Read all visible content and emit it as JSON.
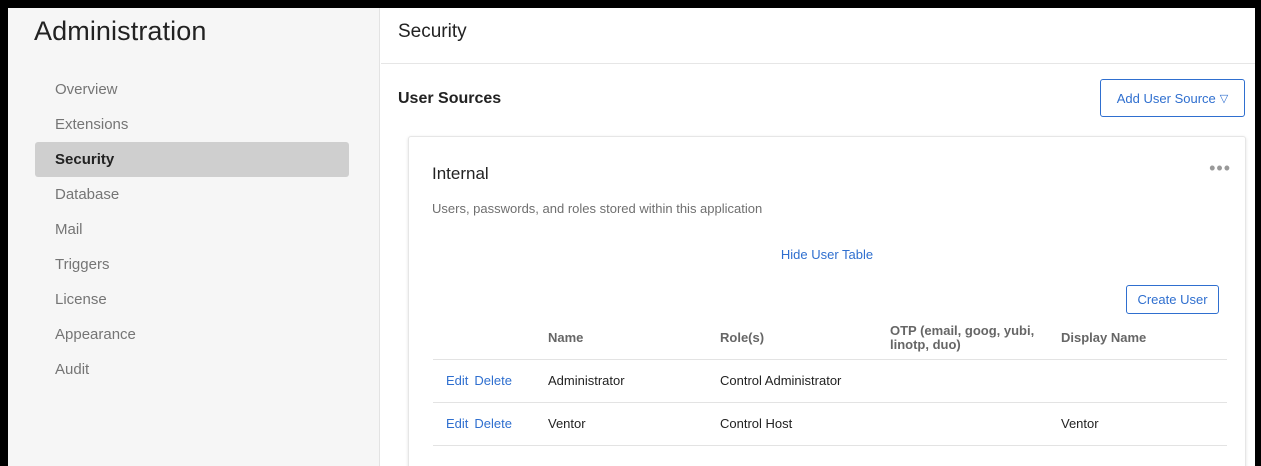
{
  "sidebar": {
    "title": "Administration",
    "items": [
      {
        "label": "Overview",
        "active": false
      },
      {
        "label": "Extensions",
        "active": false
      },
      {
        "label": "Security",
        "active": true
      },
      {
        "label": "Database",
        "active": false
      },
      {
        "label": "Mail",
        "active": false
      },
      {
        "label": "Triggers",
        "active": false
      },
      {
        "label": "License",
        "active": false
      },
      {
        "label": "Appearance",
        "active": false
      },
      {
        "label": "Audit",
        "active": false
      }
    ]
  },
  "header": {
    "title": "Security"
  },
  "user_sources": {
    "title": "User Sources",
    "add_button": "Add User Source",
    "add_button_icon": "caret-down-icon",
    "card": {
      "title": "Internal",
      "menu_icon": "more-horizontal-icon",
      "description": "Users, passwords, and roles stored within this application",
      "toggle_link": "Hide User Table",
      "create_button": "Create User",
      "columns": [
        "Name",
        "Role(s)",
        "OTP (email, goog, yubi, linotp, duo)",
        "Display Name"
      ],
      "rows": [
        {
          "edit": "Edit",
          "delete": "Delete",
          "name": "Administrator",
          "role": "Control Administrator",
          "otp": "",
          "display_name": ""
        },
        {
          "edit": "Edit",
          "delete": "Delete",
          "name": "Ventor",
          "role": "Control Host",
          "otp": "",
          "display_name": "Ventor"
        }
      ]
    }
  },
  "colors": {
    "accent": "#2f6fcf",
    "sidebar_bg": "#f6f6f6",
    "active_item_bg": "#cfcfcf"
  }
}
